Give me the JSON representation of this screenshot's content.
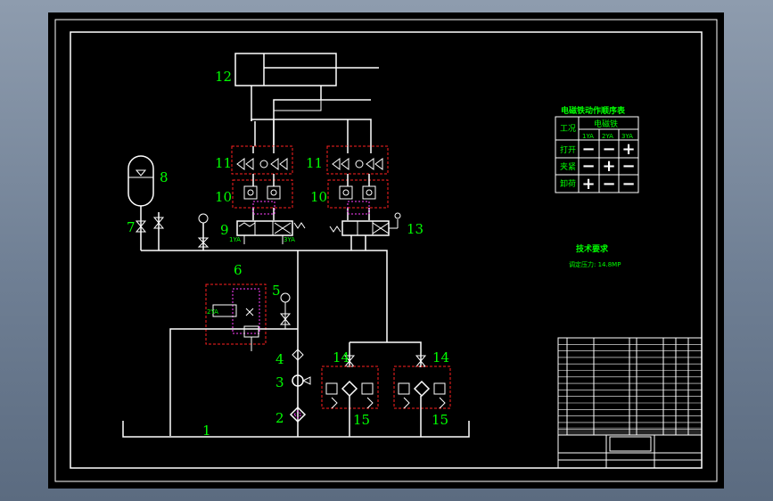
{
  "components": {
    "c1": "1",
    "c2": "2",
    "c3": "3",
    "c4": "4",
    "c5": "5",
    "c6": "6",
    "c7": "7",
    "c8": "8",
    "c9": "9",
    "c10a": "10",
    "c10b": "10",
    "c11a": "11",
    "c11b": "11",
    "c12": "12",
    "c13": "13",
    "c14a": "14",
    "c14b": "14",
    "c15a": "15",
    "c15b": "15"
  },
  "coil_labels": {
    "y1": "1YA",
    "y2": "2YA",
    "y3": "3YA"
  },
  "sequence_table": {
    "title": "电磁铁动作顺序表",
    "col_process": "工况",
    "col_group": "电磁铁",
    "coils": [
      "1YA",
      "2YA",
      "3YA"
    ],
    "rows": [
      {
        "name": "打开",
        "states": [
          "−",
          "−",
          "+"
        ]
      },
      {
        "name": "夹紧",
        "states": [
          "−",
          "+",
          "−"
        ]
      },
      {
        "name": "卸荷",
        "states": [
          "+",
          "−",
          "−"
        ]
      }
    ]
  },
  "tech": {
    "title": "技术要求",
    "line1": "调定压力: 14.8MP"
  },
  "colors": {
    "line": "#ffffff",
    "label": "#00ff00",
    "box": "#ff2020",
    "aux": "#ff40ff"
  }
}
